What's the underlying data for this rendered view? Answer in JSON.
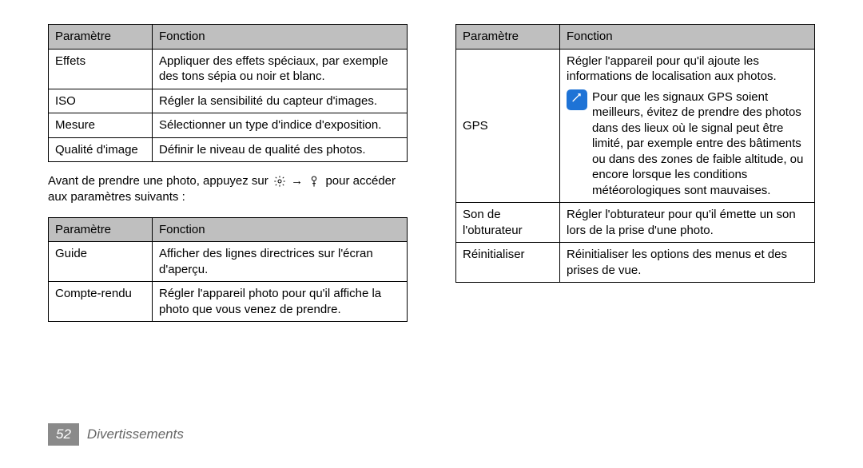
{
  "tableHeaders": {
    "param": "Paramètre",
    "func": "Fonction"
  },
  "left": {
    "table1": [
      {
        "param": "Effets",
        "func": "Appliquer des effets spéciaux, par exemple des tons sépia ou noir et blanc."
      },
      {
        "param": "ISO",
        "func": "Régler la sensibilité du capteur d'images."
      },
      {
        "param": "Mesure",
        "func": "Sélectionner un type d'indice d'exposition."
      },
      {
        "param": "Qualité d'image",
        "func": "Définir le niveau de qualité des photos."
      }
    ],
    "intertext_before": "Avant de prendre une photo, appuyez sur ",
    "intertext_after": " pour accéder aux paramètres suivants :",
    "arrow": "→",
    "table2": [
      {
        "param": "Guide",
        "func": "Afficher des lignes directrices sur l'écran d'aperçu."
      },
      {
        "param": "Compte-rendu",
        "func": "Régler l'appareil photo pour qu'il affiche la photo que vous venez de prendre."
      }
    ]
  },
  "right": {
    "rows": [
      {
        "param": "GPS",
        "func": "Régler l'appareil pour qu'il ajoute les informations de localisation aux photos.",
        "note": "Pour que les signaux GPS soient meilleurs, évitez de prendre des photos dans des lieux où le signal peut être limité, par exemple entre des bâtiments ou dans des zones de faible altitude, ou encore lorsque les conditions météorologiques sont mauvaises."
      },
      {
        "param": "Son de l'obturateur",
        "func": "Régler l'obturateur pour qu'il émette un son lors de la prise d'une photo."
      },
      {
        "param": "Réinitialiser",
        "func": "Réinitialiser les options des menus et des prises de vue."
      }
    ]
  },
  "footer": {
    "page": "52",
    "section": "Divertissements"
  }
}
